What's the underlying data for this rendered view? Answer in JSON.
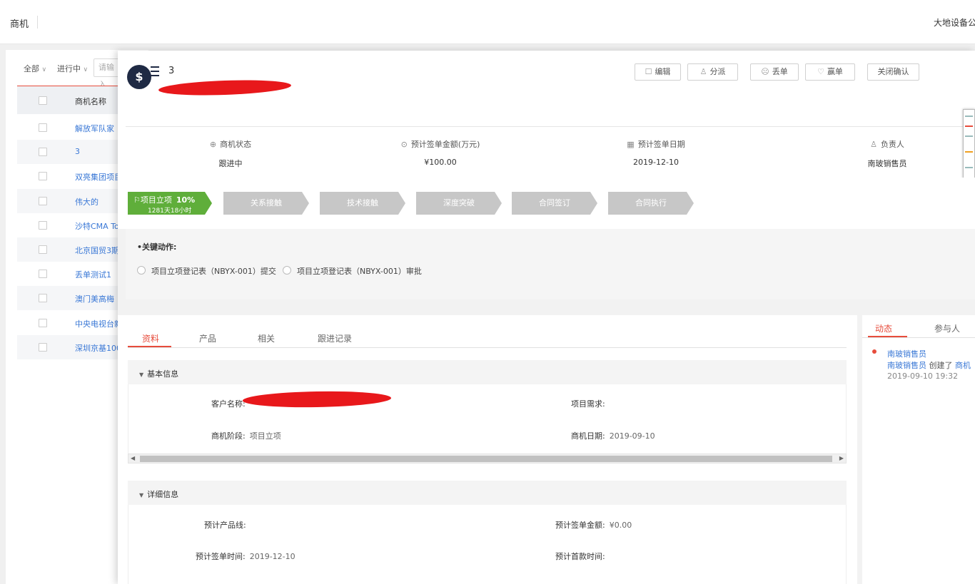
{
  "topbar": {
    "title": "商机",
    "company": "大地设备公司"
  },
  "list": {
    "filter_all": "全部",
    "filter_status": "进行中",
    "search_placeholder": "请输入",
    "column_name": "商机名称",
    "rows": [
      "解放军队家",
      "3",
      "双亮集团项目",
      "伟大的",
      "沙特CMA To",
      "北京国贸3期",
      "丢单测试1",
      "澳门美高梅",
      "中央电视台新",
      "深圳京基100"
    ]
  },
  "detail": {
    "avatar_glyph": "$",
    "record_name": "3",
    "buttons": {
      "edit": "编辑",
      "assign": "分派",
      "lose": "丢单",
      "win": "赢单",
      "close_confirm": "关闭确认"
    },
    "stats": [
      {
        "icon": "target-icon",
        "label": "商机状态",
        "value": "跟进中"
      },
      {
        "icon": "money-icon",
        "label": "预计签单金额(万元)",
        "value": "¥100.00"
      },
      {
        "icon": "calendar-icon",
        "label": "预计签单日期",
        "value": "2019-12-10"
      },
      {
        "icon": "user-icon",
        "label": "负责人",
        "value": "南玻销售员"
      }
    ],
    "stages": {
      "active_label": "项目立项",
      "active_percent": "10%",
      "active_duration": "1281天18小时",
      "others": [
        "关系接触",
        "技术接触",
        "深度突破",
        "合同签订",
        "合同执行"
      ]
    },
    "key_actions": {
      "title": "•关键动作:",
      "items": [
        "项目立项登记表（NBYX-001）提交",
        "项目立项登记表（NBYX-001）审批"
      ]
    },
    "tabs": [
      "资料",
      "产品",
      "相关",
      "跟进记录"
    ],
    "basic": {
      "title": "基本信息",
      "customer_label": "客户名称:",
      "requirement_label": "项目需求:",
      "stage_label": "商机阶段:",
      "stage_value": "项目立项",
      "date_label": "商机日期:",
      "date_value": "2019-09-10"
    },
    "detail_info": {
      "title": "详细信息",
      "product_line_label": "预计产品线:",
      "amount_label": "预计签单金额:",
      "amount_value": "¥0.00",
      "sign_time_label": "预计签单时间:",
      "sign_time_value": "2019-12-10",
      "first_payment_label": "预计首款时间:"
    },
    "side": {
      "tab_activity": "动态",
      "tab_participants": "参与人",
      "actor": "南玻销售员",
      "line_actor": "南玻销售员",
      "line_action": "创建了",
      "line_object": "商机",
      "time": "2019-09-10 19:32"
    }
  },
  "colors": {
    "accent": "#e74c3c",
    "active_stage": "#5fae3a",
    "inactive_stage": "#c7c7c7",
    "link": "#3a78d6",
    "redaction": "#e8181b"
  }
}
